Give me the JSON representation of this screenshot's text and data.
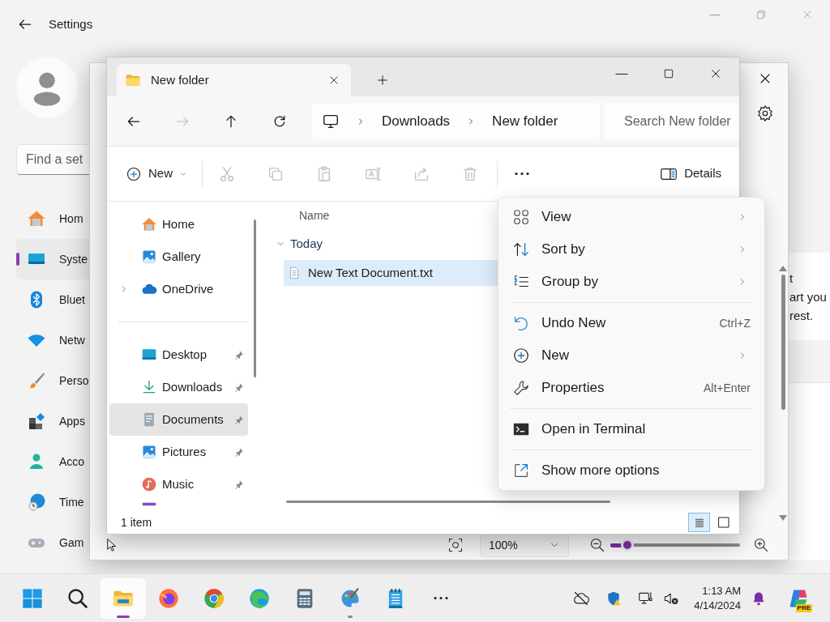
{
  "settings": {
    "title": "Settings",
    "search": {
      "placeholder": "Find a set"
    },
    "nav": [
      {
        "label": "Hom",
        "selected": false
      },
      {
        "label": "Syste",
        "selected": true
      },
      {
        "label": "Bluet",
        "selected": false
      },
      {
        "label": "Netw",
        "selected": false
      },
      {
        "label": "Perso",
        "selected": false
      },
      {
        "label": "Apps",
        "selected": false
      },
      {
        "label": "Acco",
        "selected": false
      },
      {
        "label": "Time",
        "selected": false
      },
      {
        "label": "Gam",
        "selected": false
      }
    ],
    "card_lines": [
      "t",
      "art you",
      "rest."
    ]
  },
  "paint": {
    "zoom": "100%",
    "zoom_slider": {
      "level": 0.13
    }
  },
  "explorer": {
    "tab": "New folder",
    "nav_buttons": [
      {
        "disabled": false
      },
      {
        "disabled": true
      },
      {
        "disabled": false
      },
      {
        "disabled": false
      }
    ],
    "path": [
      "Downloads",
      "New folder"
    ],
    "search": {
      "placeholder": "Search New folder"
    },
    "toolbar": {
      "new": "New",
      "actions": [
        {
          "disabled": true
        },
        {
          "disabled": true
        },
        {
          "disabled": true
        },
        {
          "disabled": true
        },
        {
          "disabled": true
        },
        {
          "disabled": true
        }
      ],
      "details": "Details"
    },
    "nav_sections": [
      {
        "items": [
          {
            "label": "Home",
            "expandable": false,
            "pinned": false,
            "selected": false
          },
          {
            "label": "Gallery",
            "expandable": false,
            "pinned": false,
            "selected": false
          },
          {
            "label": "OneDrive",
            "expandable": true,
            "pinned": false,
            "selected": false
          }
        ]
      },
      {
        "items": [
          {
            "label": "Desktop",
            "expandable": false,
            "pinned": true,
            "selected": false
          },
          {
            "label": "Downloads",
            "expandable": false,
            "pinned": true,
            "selected": false
          },
          {
            "label": "Documents",
            "expandable": false,
            "pinned": true,
            "selected": true
          },
          {
            "label": "Pictures",
            "expandable": false,
            "pinned": true,
            "selected": false
          },
          {
            "label": "Music",
            "expandable": false,
            "pinned": true,
            "selected": false
          }
        ]
      }
    ],
    "columns": [
      "Name"
    ],
    "groups": [
      {
        "label": "Today",
        "expanded": true,
        "files": [
          {
            "name": "New Text Document.txt",
            "selected": true
          }
        ]
      }
    ],
    "status": "1 item",
    "views": [
      {
        "selected": true
      },
      {
        "selected": false
      }
    ]
  },
  "context_menu": [
    {
      "kind": "item",
      "label": "View",
      "submenu": true
    },
    {
      "kind": "item",
      "label": "Sort by",
      "submenu": true
    },
    {
      "kind": "item",
      "label": "Group by",
      "submenu": true
    },
    {
      "kind": "separator"
    },
    {
      "kind": "item",
      "label": "Undo New",
      "shortcut": "Ctrl+Z"
    },
    {
      "kind": "item",
      "label": "New",
      "submenu": true
    },
    {
      "kind": "item",
      "label": "Properties",
      "shortcut": "Alt+Enter"
    },
    {
      "kind": "separator"
    },
    {
      "kind": "item",
      "label": "Open in Terminal"
    },
    {
      "kind": "separator"
    },
    {
      "kind": "item",
      "label": "Show more options"
    }
  ],
  "taskbar": {
    "apps": [
      {
        "active": false,
        "running": false
      },
      {
        "active": false,
        "running": false
      },
      {
        "active": true,
        "running": true
      },
      {
        "active": false,
        "running": false
      },
      {
        "active": false,
        "running": false
      },
      {
        "active": false,
        "running": false
      },
      {
        "active": false,
        "running": false
      },
      {
        "active": false,
        "running": true
      },
      {
        "active": false,
        "running": false
      },
      {
        "active": false,
        "running": false
      }
    ],
    "clock": {
      "time": "1:13 AM",
      "date": "4/14/2024"
    },
    "copilot_badge": "PRE"
  }
}
